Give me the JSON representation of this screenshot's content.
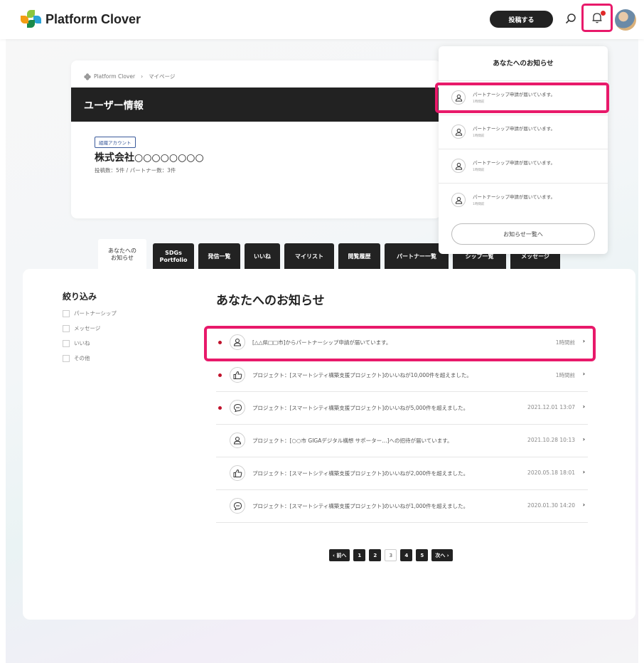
{
  "header": {
    "logo_text": "Platform Clover",
    "post_button": "投稿する",
    "search_icon": "search-icon",
    "bell_icon": "bell-icon"
  },
  "breadcrumb": {
    "home": "Platform Clover",
    "separator": "›",
    "current": "マイページ"
  },
  "user_info": {
    "heading": "ユーザー情報",
    "account_badge": "組織アカウント",
    "company_name": "株式会社○○○○○○○○",
    "stats": "投稿数：5件 / パートナー数：3件"
  },
  "tabs": [
    {
      "label": "あなたへの\nお知らせ"
    },
    {
      "label": "SDGs\nPortfolio"
    },
    {
      "label": "発信一覧"
    },
    {
      "label": "いいね"
    },
    {
      "label": "マイリスト"
    },
    {
      "label": "閲覧履歴"
    },
    {
      "label": "パートナー一覧"
    },
    {
      "label": "シップ一覧"
    },
    {
      "label": "メッセージ"
    }
  ],
  "filter": {
    "title": "絞り込み",
    "options": [
      "パートナーシップ",
      "メッセージ",
      "いいね",
      "その他"
    ]
  },
  "notifications": {
    "title": "あなたへのお知らせ",
    "items": [
      {
        "text": "[△△県□□市]からパートナーシップ申請が届いています。",
        "time": "1時間前",
        "unread": true,
        "icon": "user-icon"
      },
      {
        "text": "プロジェクト：[スマートシティ構築支援プロジェクト]のいいねが10,000件を超えました。",
        "time": "1時間前",
        "unread": true,
        "icon": "thumbs-up-icon"
      },
      {
        "text": "プロジェクト：[スマートシティ構築支援プロジェクト]のいいねが5,000件を超えました。",
        "time": "2021.12.01 13:07",
        "unread": true,
        "icon": "message-icon"
      },
      {
        "text": "プロジェクト：[○○市 GIGAデジタル構想 サポーター…]への招待が届いています。",
        "time": "2021.10.28 10:13",
        "unread": false,
        "icon": "user-icon"
      },
      {
        "text": "プロジェクト：[スマートシティ構築支援プロジェクト]のいいねが2,000件を超えました。",
        "time": "2020.05.18 18:01",
        "unread": false,
        "icon": "thumbs-up-icon"
      },
      {
        "text": "プロジェクト：[スマートシティ構築支援プロジェクト]のいいねが1,000件を超えました。",
        "time": "2020.01.30 14:20",
        "unread": false,
        "icon": "message-icon"
      }
    ]
  },
  "pagination": {
    "prev": "‹ 前へ",
    "pages": [
      "1",
      "2",
      "3",
      "4",
      "5"
    ],
    "current": "3",
    "next": "次へ ›"
  },
  "dropdown": {
    "title": "あなたへのお知らせ",
    "items": [
      {
        "text": "パートナーシップ申請が届いています。",
        "time": "1時間前"
      },
      {
        "text": "パートナーシップ申請が届いています。",
        "time": "1時間前"
      },
      {
        "text": "パートナーシップ申請が届いています。",
        "time": "1時間前"
      },
      {
        "text": "パートナーシップ申請が届いています。",
        "time": "1時間前"
      }
    ],
    "all_button": "お知らせ一覧へ"
  },
  "colors": {
    "accent_highlight": "#e8196a",
    "unread_dot": "#c0122c",
    "dark": "#222222"
  }
}
